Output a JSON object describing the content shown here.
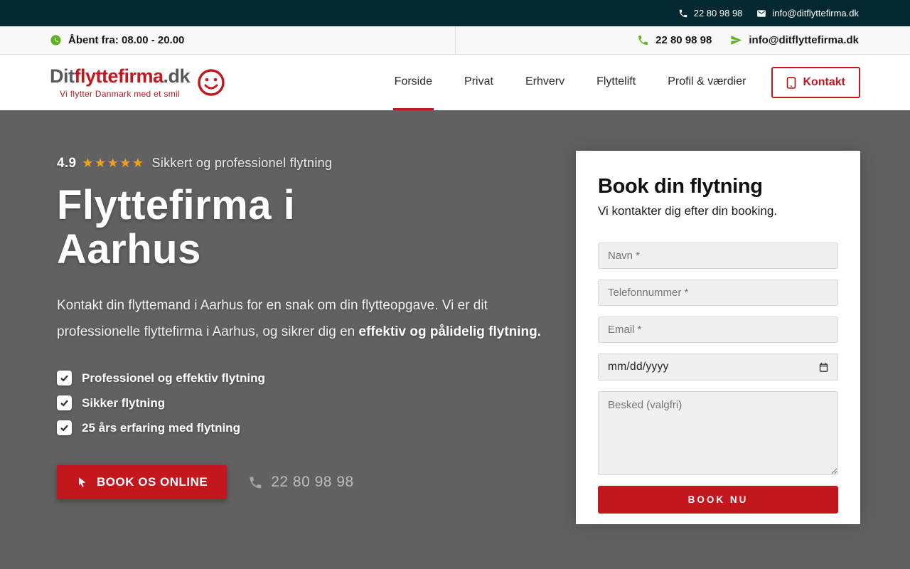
{
  "topbar": {
    "phone": "22 80 98 98",
    "email": "info@ditflyttefirma.dk"
  },
  "infobar": {
    "hours": "Åbent fra: 08.00 - 20.00",
    "phone": "22 80 98 98",
    "email": "info@ditflyttefirma.dk"
  },
  "header": {
    "logo": {
      "part1": "Dit",
      "part2": "flyttefirma",
      "part3": ".dk",
      "tagline": "Vi flytter Danmark med et smil"
    },
    "nav": [
      {
        "label": "Forside"
      },
      {
        "label": "Privat"
      },
      {
        "label": "Erhverv"
      },
      {
        "label": "Flyttelift"
      },
      {
        "label": "Profil & værdier"
      }
    ],
    "contact_button": "Kontakt"
  },
  "hero": {
    "rating_score": "4.9",
    "rating_stars": "★★★★★",
    "rating_text": "Sikkert og professionel flytning",
    "title": "Flyttefirma i Aarhus",
    "paragraph_normal": "Kontakt din flyttemand i Aarhus for en snak om din flytteopgave. Vi er dit professionelle flyttefirma i Aarhus, og sikrer dig en ",
    "paragraph_bold": "effektiv og pålidelig flytning.",
    "checklist": [
      "Professionel og effektiv flytning",
      "Sikker flytning",
      "25 års erfaring med flytning"
    ],
    "cta_button": "BOOK OS ONLINE",
    "phone": "22 80 98 98"
  },
  "form": {
    "title": "Book din flytning",
    "subtitle": "Vi kontakter dig efter din booking.",
    "name_placeholder": "Navn *",
    "phone_placeholder": "Telefonnummer *",
    "email_placeholder": "Email *",
    "date_placeholder": "mm/dd/yyyy",
    "message_placeholder": "Besked (valgfri)",
    "submit_label": "BOOK NU"
  },
  "colors": {
    "accent_red": "#c3161d",
    "accent_green": "#5eb41f",
    "topbar_dark": "#032830",
    "hero_gray": "#616161",
    "star_gold": "#f0a50f"
  }
}
